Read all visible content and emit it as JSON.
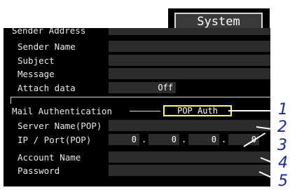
{
  "system_tab": {
    "label": "System"
  },
  "email_fields": [
    {
      "label": "Sender Address",
      "value": ""
    },
    {
      "label": "Sender Name",
      "value": ""
    },
    {
      "label": "Subject",
      "value": ""
    },
    {
      "label": "Message",
      "value": ""
    },
    {
      "label": "Attach data",
      "value": "Off"
    }
  ],
  "mail_auth": {
    "label": "Mail Authentication",
    "value": "POP Auth",
    "server_name": {
      "label": "Server Name(POP)",
      "value": ""
    },
    "ip_port": {
      "label": "IP / Port(POP)",
      "octets": [
        "0",
        "0",
        "0",
        "0"
      ]
    },
    "account_name": {
      "label": "Account Name",
      "value": ""
    },
    "password": {
      "label": "Password",
      "value": ""
    }
  },
  "callouts": [
    "1",
    "2",
    "3",
    "4",
    "5"
  ]
}
